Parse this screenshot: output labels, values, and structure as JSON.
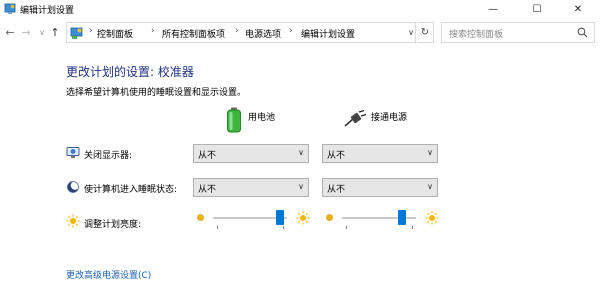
{
  "window": {
    "title": "编辑计划设置",
    "min_glyph": "—",
    "max_glyph": "☐",
    "close_glyph": "✕"
  },
  "nav": {
    "back_glyph": "←",
    "forward_glyph": "→",
    "recent_glyph": "∨",
    "up_glyph": "↑"
  },
  "breadcrumb": {
    "sep": "›",
    "items": [
      "控制面板",
      "所有控制面板项",
      "电源选项",
      "编辑计划设置"
    ]
  },
  "address": {
    "dropdown_glyph": "∨",
    "refresh_glyph": "↻"
  },
  "search": {
    "placeholder": "搜索控制面板"
  },
  "content": {
    "title": "更改计划的设置: 校准器",
    "description": "选择希望计算机使用的睡眠设置和显示设置。",
    "columns": {
      "battery": "用电池",
      "plugged": "接通电源"
    },
    "rows": {
      "display_off": {
        "label": "关闭显示器:",
        "battery_value": "从不",
        "plugged_value": "从不"
      },
      "sleep": {
        "label": "使计算机进入睡眠状态:",
        "battery_value": "从不",
        "plugged_value": "从不"
      },
      "brightness": {
        "label": "调整计划亮度:",
        "battery_level": 0.95,
        "plugged_level": 0.85
      }
    },
    "select_arrow": "∨",
    "advanced_link": "更改高级电源设置(C)"
  },
  "colors": {
    "title": "#1e3287",
    "link": "#1a5fb4",
    "slider_thumb": "#0078d7"
  }
}
